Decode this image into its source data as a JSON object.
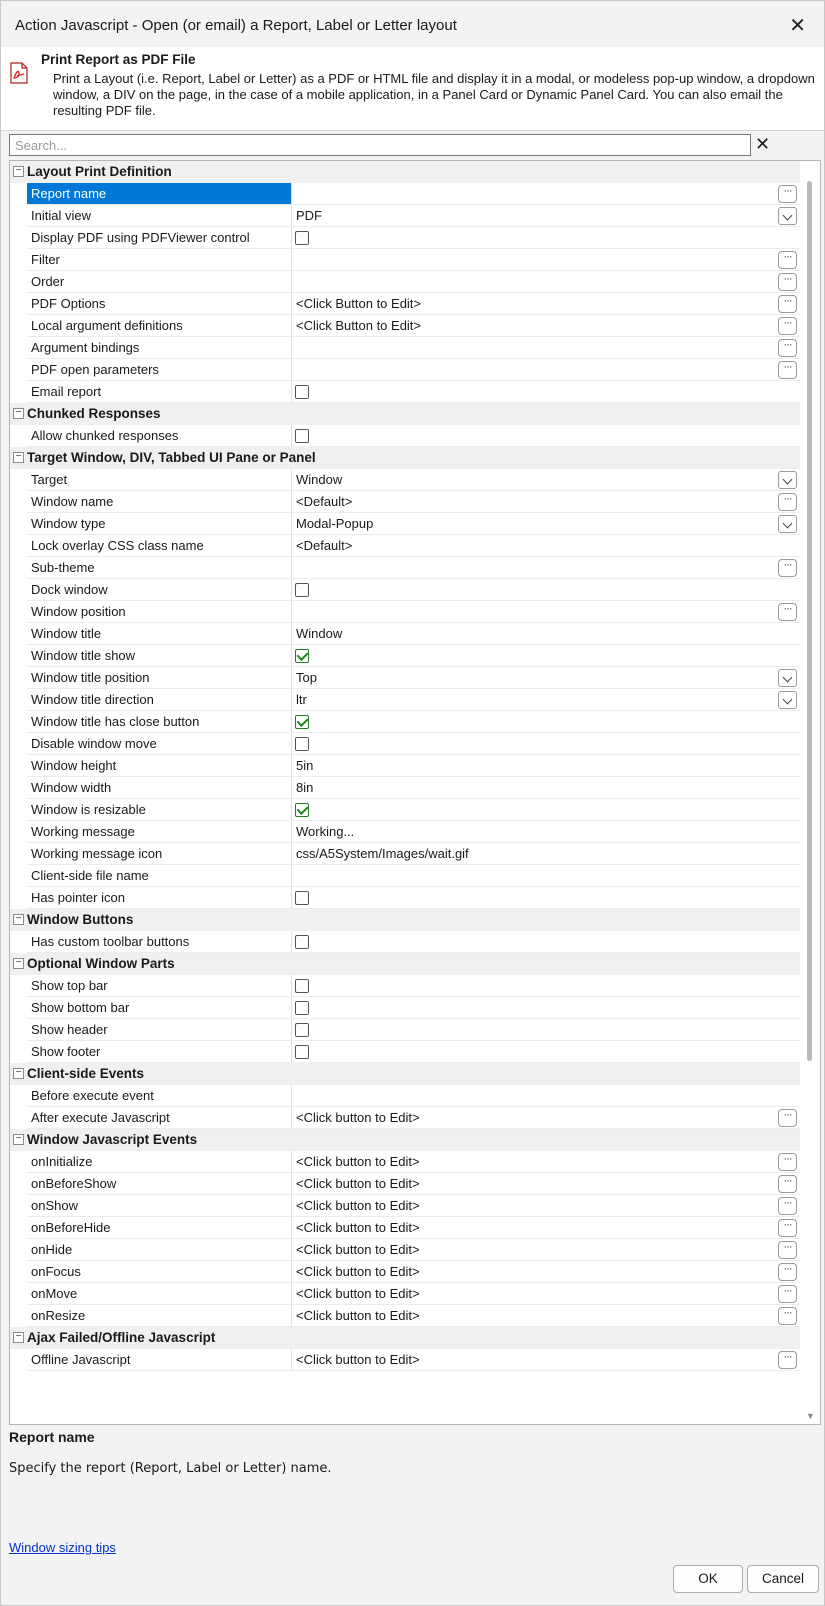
{
  "window": {
    "title": "Action Javascript - Open (or email) a Report, Label or Letter layout",
    "close_glyph": "✕"
  },
  "description": {
    "icon": "pdf-file-icon",
    "heading": "Print Report as PDF File",
    "text": "Print a Layout (i.e. Report, Label or Letter) as a PDF or HTML file and display it in a modal, or modeless pop-up window, a dropdown window, a DIV on the page, in the case of a mobile application, in a Panel Card or Dynamic Panel Card. You can also email the resulting PDF file."
  },
  "search": {
    "placeholder": "Search...",
    "value": "",
    "clear_glyph": "✕"
  },
  "grid": {
    "toggle_glyph": "−",
    "ellipsis_glyph": "···",
    "sections": [
      {
        "title": "Layout Print Definition",
        "rows": [
          {
            "name": "Report name",
            "value": "",
            "control": "ellipsis",
            "selected": true
          },
          {
            "name": "Initial view",
            "value": "PDF",
            "control": "dropdown"
          },
          {
            "name": "Display PDF using PDFViewer control",
            "checkbox": false
          },
          {
            "name": "Filter",
            "value": "",
            "control": "ellipsis"
          },
          {
            "name": "Order",
            "value": "",
            "control": "ellipsis"
          },
          {
            "name": "PDF Options",
            "value": "<Click Button to Edit>",
            "control": "ellipsis"
          },
          {
            "name": "Local argument definitions",
            "value": "<Click Button to Edit>",
            "control": "ellipsis"
          },
          {
            "name": "Argument bindings",
            "value": "",
            "control": "ellipsis"
          },
          {
            "name": "PDF open parameters",
            "value": "",
            "control": "ellipsis"
          },
          {
            "name": "Email report",
            "checkbox": false
          }
        ]
      },
      {
        "title": "Chunked Responses",
        "rows": [
          {
            "name": "Allow chunked responses",
            "checkbox": false
          }
        ]
      },
      {
        "title": "Target Window, DIV, Tabbed UI Pane or Panel",
        "rows": [
          {
            "name": "Target",
            "value": "Window",
            "control": "dropdown"
          },
          {
            "name": "Window name",
            "value": "<Default>",
            "control": "ellipsis"
          },
          {
            "name": "Window type",
            "value": "Modal-Popup",
            "control": "dropdown"
          },
          {
            "name": "Lock overlay CSS class name",
            "value": "<Default>"
          },
          {
            "name": "Sub-theme",
            "value": "",
            "control": "ellipsis"
          },
          {
            "name": "Dock window",
            "checkbox": false
          },
          {
            "name": "Window position",
            "value": "",
            "control": "ellipsis"
          },
          {
            "name": "Window title",
            "value": "Window"
          },
          {
            "name": "Window title show",
            "checkbox": true
          },
          {
            "name": "Window title position",
            "value": "Top",
            "control": "dropdown"
          },
          {
            "name": "Window title direction",
            "value": "ltr",
            "control": "dropdown"
          },
          {
            "name": "Window title has close button",
            "checkbox": true
          },
          {
            "name": "Disable window move",
            "checkbox": false
          },
          {
            "name": "Window height",
            "value": "5in"
          },
          {
            "name": "Window width",
            "value": "8in"
          },
          {
            "name": "Window is resizable",
            "checkbox": true
          },
          {
            "name": "Working message",
            "value": "Working..."
          },
          {
            "name": "Working message icon",
            "value": "css/A5System/Images/wait.gif"
          },
          {
            "name": "Client-side file name",
            "value": ""
          },
          {
            "name": "Has pointer icon",
            "checkbox": false
          }
        ]
      },
      {
        "title": "Window Buttons",
        "rows": [
          {
            "name": "Has custom toolbar buttons",
            "checkbox": false
          }
        ]
      },
      {
        "title": "Optional Window Parts",
        "rows": [
          {
            "name": "Show top bar",
            "checkbox": false
          },
          {
            "name": "Show bottom bar",
            "checkbox": false
          },
          {
            "name": "Show header",
            "checkbox": false
          },
          {
            "name": "Show footer",
            "checkbox": false
          }
        ]
      },
      {
        "title": "Client-side Events",
        "rows": [
          {
            "name": "Before execute event",
            "value": ""
          },
          {
            "name": "After execute Javascript",
            "value": "<Click button to Edit>",
            "control": "ellipsis"
          }
        ]
      },
      {
        "title": "Window Javascript Events",
        "rows": [
          {
            "name": "onInitialize",
            "value": "<Click button to Edit>",
            "control": "ellipsis"
          },
          {
            "name": "onBeforeShow",
            "value": "<Click button to Edit>",
            "control": "ellipsis"
          },
          {
            "name": "onShow",
            "value": "<Click button to Edit>",
            "control": "ellipsis"
          },
          {
            "name": "onBeforeHide",
            "value": "<Click button to Edit>",
            "control": "ellipsis"
          },
          {
            "name": "onHide",
            "value": "<Click button to Edit>",
            "control": "ellipsis"
          },
          {
            "name": "onFocus",
            "value": "<Click button to Edit>",
            "control": "ellipsis"
          },
          {
            "name": "onMove",
            "value": "<Click button to Edit>",
            "control": "ellipsis"
          },
          {
            "name": "onResize",
            "value": "<Click button to Edit>",
            "control": "ellipsis"
          }
        ]
      },
      {
        "title": "Ajax Failed/Offline Javascript",
        "rows": [
          {
            "name": "Offline Javascript",
            "value": "<Click button to Edit>",
            "control": "ellipsis"
          }
        ]
      }
    ]
  },
  "help": {
    "title": "Report name",
    "text": "Specify the report (Report, Label or Letter) name.",
    "link": "Window sizing tips"
  },
  "buttons": {
    "ok": "OK",
    "cancel": "Cancel"
  },
  "colors": {
    "selection": "#0078d7",
    "link": "#0033cc",
    "check": "#1e8a1e"
  }
}
